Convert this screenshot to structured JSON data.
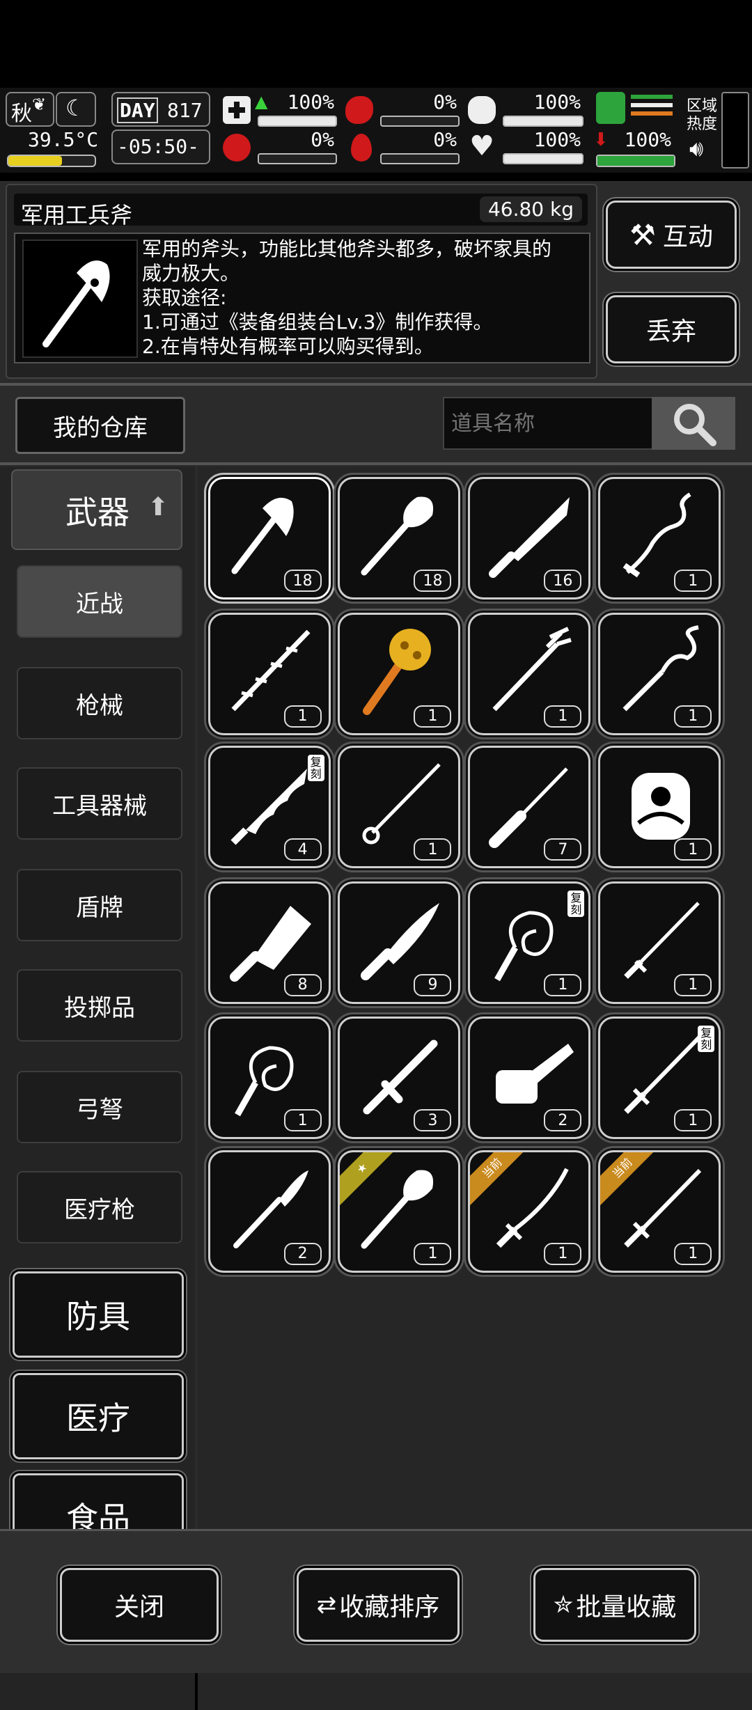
{
  "status": {
    "season": "秋",
    "temperature": "39.5°C",
    "day_label": "DAY",
    "day": "817",
    "time": "-05:50-",
    "stats": [
      {
        "icon": "medkit-icon",
        "value": "100%",
        "fill": 1.0
      },
      {
        "icon": "stomach-icon",
        "value": "0%",
        "fill": 0.0
      },
      {
        "icon": "battery-icon",
        "value": "100%",
        "fill": 1.0
      },
      {
        "icon": "virus-icon",
        "value": "0%",
        "fill": 0.0
      },
      {
        "icon": "blood-drop-icon",
        "value": "0%",
        "fill": 0.0
      },
      {
        "icon": "heart-icon",
        "value": "100%",
        "fill": 1.0
      }
    ],
    "stamina": {
      "value": "100%",
      "fill": 1.0
    },
    "area_heat": "区域热度"
  },
  "item": {
    "name": "军用工兵斧",
    "weight": "46.80 kg",
    "desc": [
      "军用的斧头，功能比其他斧头都多，破坏家具的",
      "威力极大。",
      "获取途径:",
      "1.可通过《装备组装台Lv.3》制作获得。",
      "2.在肯特处有概率可以购买得到。"
    ],
    "interact_label": "互动",
    "discard_label": "丢弃"
  },
  "storage": {
    "title": "我的仓库",
    "search_placeholder": "道具名称"
  },
  "categories": {
    "weapon_label": "武器",
    "subs": [
      "近战",
      "枪械",
      "工具器械",
      "盾牌",
      "投掷品",
      "弓弩",
      "医疗枪"
    ],
    "others": [
      "防具",
      "医疗",
      "食品"
    ]
  },
  "slots": [
    {
      "icon": "engineer-axe-icon",
      "count": "18",
      "selected": true
    },
    {
      "icon": "shovel-icon",
      "count": "18"
    },
    {
      "icon": "machete-icon",
      "count": "16"
    },
    {
      "icon": "serpent-blade-icon",
      "count": "1"
    },
    {
      "icon": "thorn-staff-icon",
      "count": "1"
    },
    {
      "icon": "golden-mace-icon",
      "count": "1"
    },
    {
      "icon": "trident-icon",
      "count": "1"
    },
    {
      "icon": "wavy-staff-icon",
      "count": "1"
    },
    {
      "icon": "serrated-sword-icon",
      "count": "4",
      "tag": "复刻"
    },
    {
      "icon": "rapier-icon",
      "count": "1"
    },
    {
      "icon": "screwdriver-icon",
      "count": "7"
    },
    {
      "icon": "gauntlet-icon",
      "count": "1"
    },
    {
      "icon": "cleaver-icon",
      "count": "8"
    },
    {
      "icon": "hunting-knife-icon",
      "count": "9"
    },
    {
      "icon": "whip-icon",
      "count": "1",
      "tag": "复刻"
    },
    {
      "icon": "katana-icon",
      "count": "1"
    },
    {
      "icon": "whip-icon",
      "count": "1"
    },
    {
      "icon": "tonfa-icon",
      "count": "3"
    },
    {
      "icon": "chainsaw-icon",
      "count": "2"
    },
    {
      "icon": "long-sword-icon",
      "count": "1",
      "tag": "复刻"
    },
    {
      "icon": "scalpel-icon",
      "count": "2"
    },
    {
      "icon": "shovel-icon",
      "count": "1",
      "ribbon": "★",
      "ribbon_kind": "fav"
    },
    {
      "icon": "curved-sword-icon",
      "count": "1",
      "ribbon": "当前"
    },
    {
      "icon": "long-sword-icon",
      "count": "1",
      "ribbon": "当前"
    }
  ],
  "bottom": {
    "close_label": "关闭",
    "sort_label": "收藏排序",
    "batch_label": "批量收藏"
  },
  "colors": {
    "panel": "#2b2b2b",
    "accent_orange": "#c98a1e",
    "health_red": "#d0191b",
    "stamina_green": "#2ea43c"
  }
}
